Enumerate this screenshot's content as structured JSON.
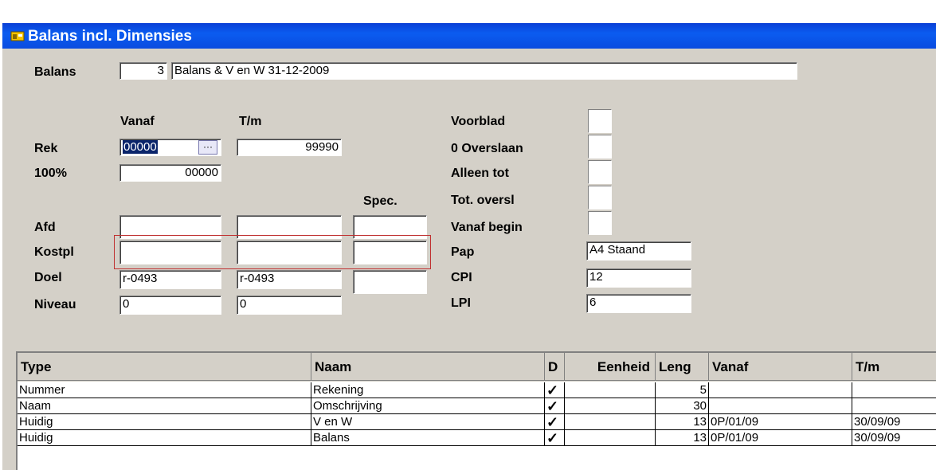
{
  "window": {
    "title": "Balans incl. Dimensies"
  },
  "balans": {
    "label": "Balans",
    "number": "3",
    "description": "Balans & V en W 31-12-2009"
  },
  "headers": {
    "vanaf": "Vanaf",
    "tm": "T/m",
    "spec": "Spec."
  },
  "rek": {
    "label": "Rek",
    "vanaf": "00000",
    "tm": "99990",
    "lookup_label": "···"
  },
  "pct": {
    "label": "100%",
    "vanaf": "00000"
  },
  "afd": {
    "label": "Afd",
    "vanaf": "",
    "tm": "",
    "spec": ""
  },
  "kostpl": {
    "label": "Kostpl",
    "vanaf": "",
    "tm": "",
    "spec": ""
  },
  "doel": {
    "label": "Doel",
    "vanaf": "r-0493",
    "tm": "r-0493",
    "spec": ""
  },
  "niveau": {
    "label": "Niveau",
    "vanaf": "0",
    "tm": "0"
  },
  "options": {
    "voorblad": "Voorblad",
    "overslaan": "0 Overslaan",
    "alleen_tot": "Alleen tot",
    "tot_oversl": "Tot. oversl",
    "vanaf_begin": "Vanaf begin"
  },
  "print": {
    "pap_label": "Pap",
    "pap": "A4 Staand",
    "cpi_label": "CPI",
    "cpi": "12",
    "lpi_label": "LPI",
    "lpi": "6"
  },
  "table": {
    "columns": [
      "Type",
      "Naam",
      "D",
      "Eenheid",
      "Leng",
      "Vanaf",
      "T/m"
    ],
    "rows": [
      {
        "type": "Nummer",
        "naam": "Rekening",
        "d": "✓",
        "eenheid": "",
        "leng": "5",
        "vanaf": "",
        "tm": ""
      },
      {
        "type": "Naam",
        "naam": "Omschrijving",
        "d": "✓",
        "eenheid": "",
        "leng": "30",
        "vanaf": "",
        "tm": ""
      },
      {
        "type": "Huidig",
        "naam": "V en W",
        "d": "✓",
        "eenheid": "",
        "leng": "13",
        "vanaf": "0P/01/09",
        "tm": "30/09/09"
      },
      {
        "type": "Huidig",
        "naam": "Balans",
        "d": "✓",
        "eenheid": "",
        "leng": "13",
        "vanaf": "0P/01/09",
        "tm": "30/09/09"
      }
    ]
  }
}
